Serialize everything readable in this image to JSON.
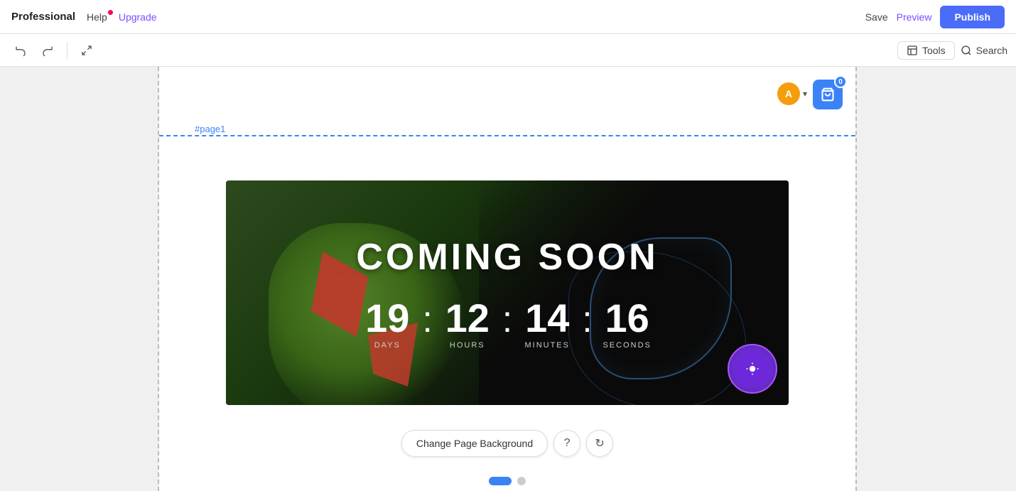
{
  "navbar": {
    "brand": "Professional",
    "help_label": "Help",
    "upgrade_label": "Upgrade",
    "save_label": "Save",
    "preview_label": "Preview",
    "publish_label": "Publish"
  },
  "toolbar": {
    "undo_label": "↩",
    "redo_label": "↪",
    "collapse_label": "⤢",
    "tools_label": "Tools",
    "search_label": "Search"
  },
  "canvas": {
    "section_label": "#page1",
    "coming_soon_title": "COMING SOON",
    "countdown": {
      "days_num": "19",
      "days_label": "DAYS",
      "hours_num": "12",
      "hours_label": "HOURS",
      "minutes_num": "14",
      "minutes_label": "MINUTES",
      "seconds_num": "16",
      "seconds_label": "SECONDS",
      "sep": ":"
    },
    "cart_count": "0",
    "avatar_letter": "A"
  },
  "bottom_toolbar": {
    "change_bg_label": "Change Page Background",
    "help_icon": "?",
    "refresh_icon": "↻"
  }
}
